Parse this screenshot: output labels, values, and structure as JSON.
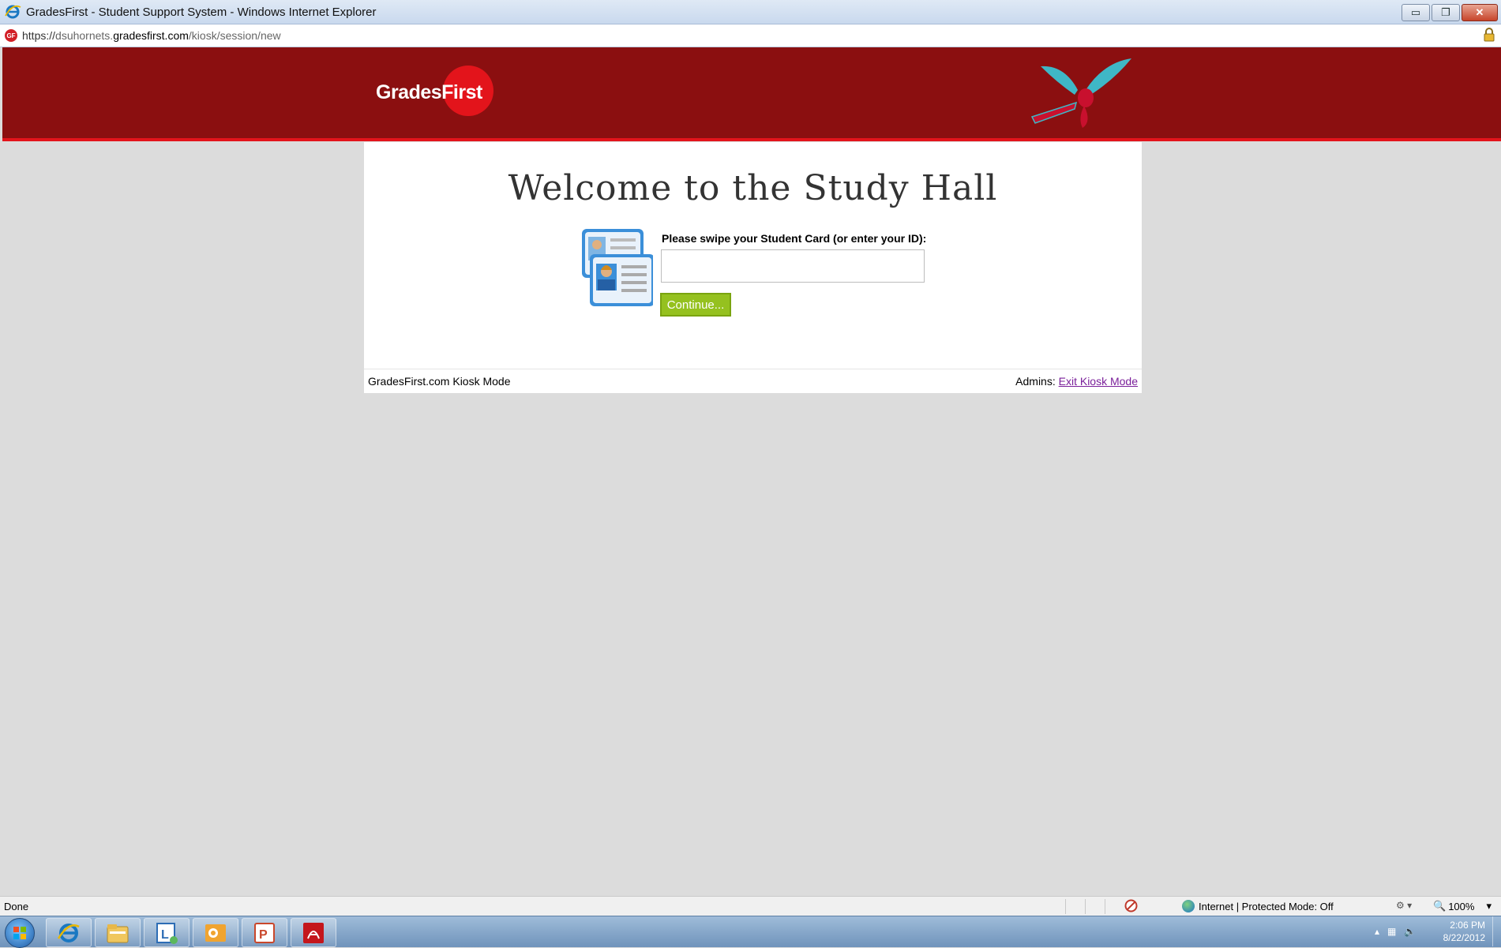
{
  "window": {
    "title": "GradesFirst - Student Support System - Windows Internet Explorer",
    "controls": {
      "minimize": "▭",
      "restore": "❐",
      "close": "✕"
    }
  },
  "address": {
    "protocol": "https://",
    "host_prefix": "dsuhornets.",
    "host_domain": "gradesfirst.com",
    "path": "/kiosk/session/new",
    "site_icon_text": "GF"
  },
  "header": {
    "logo_text": "GradesFirst",
    "brand_color": "#8b0f10",
    "accent_color": "#e3141b"
  },
  "main": {
    "welcome": "Welcome to the Study Hall",
    "prompt": "Please swipe your Student Card (or enter your ID):",
    "id_value": "",
    "continue_label": "Continue...",
    "button_color": "#95c11f"
  },
  "footer": {
    "left_text": "GradesFirst.com Kiosk Mode",
    "admins_label": "Admins:",
    "exit_link": "Exit Kiosk Mode"
  },
  "statusbar": {
    "done": "Done",
    "zone": "Internet | Protected Mode: Off",
    "zoom": "100%"
  },
  "taskbar": {
    "items": [
      "internet-explorer-icon",
      "file-explorer-icon",
      "lync-icon",
      "outlook-icon",
      "powerpoint-icon",
      "adobe-reader-icon"
    ],
    "time": "2:06 PM",
    "date": "8/22/2012"
  }
}
